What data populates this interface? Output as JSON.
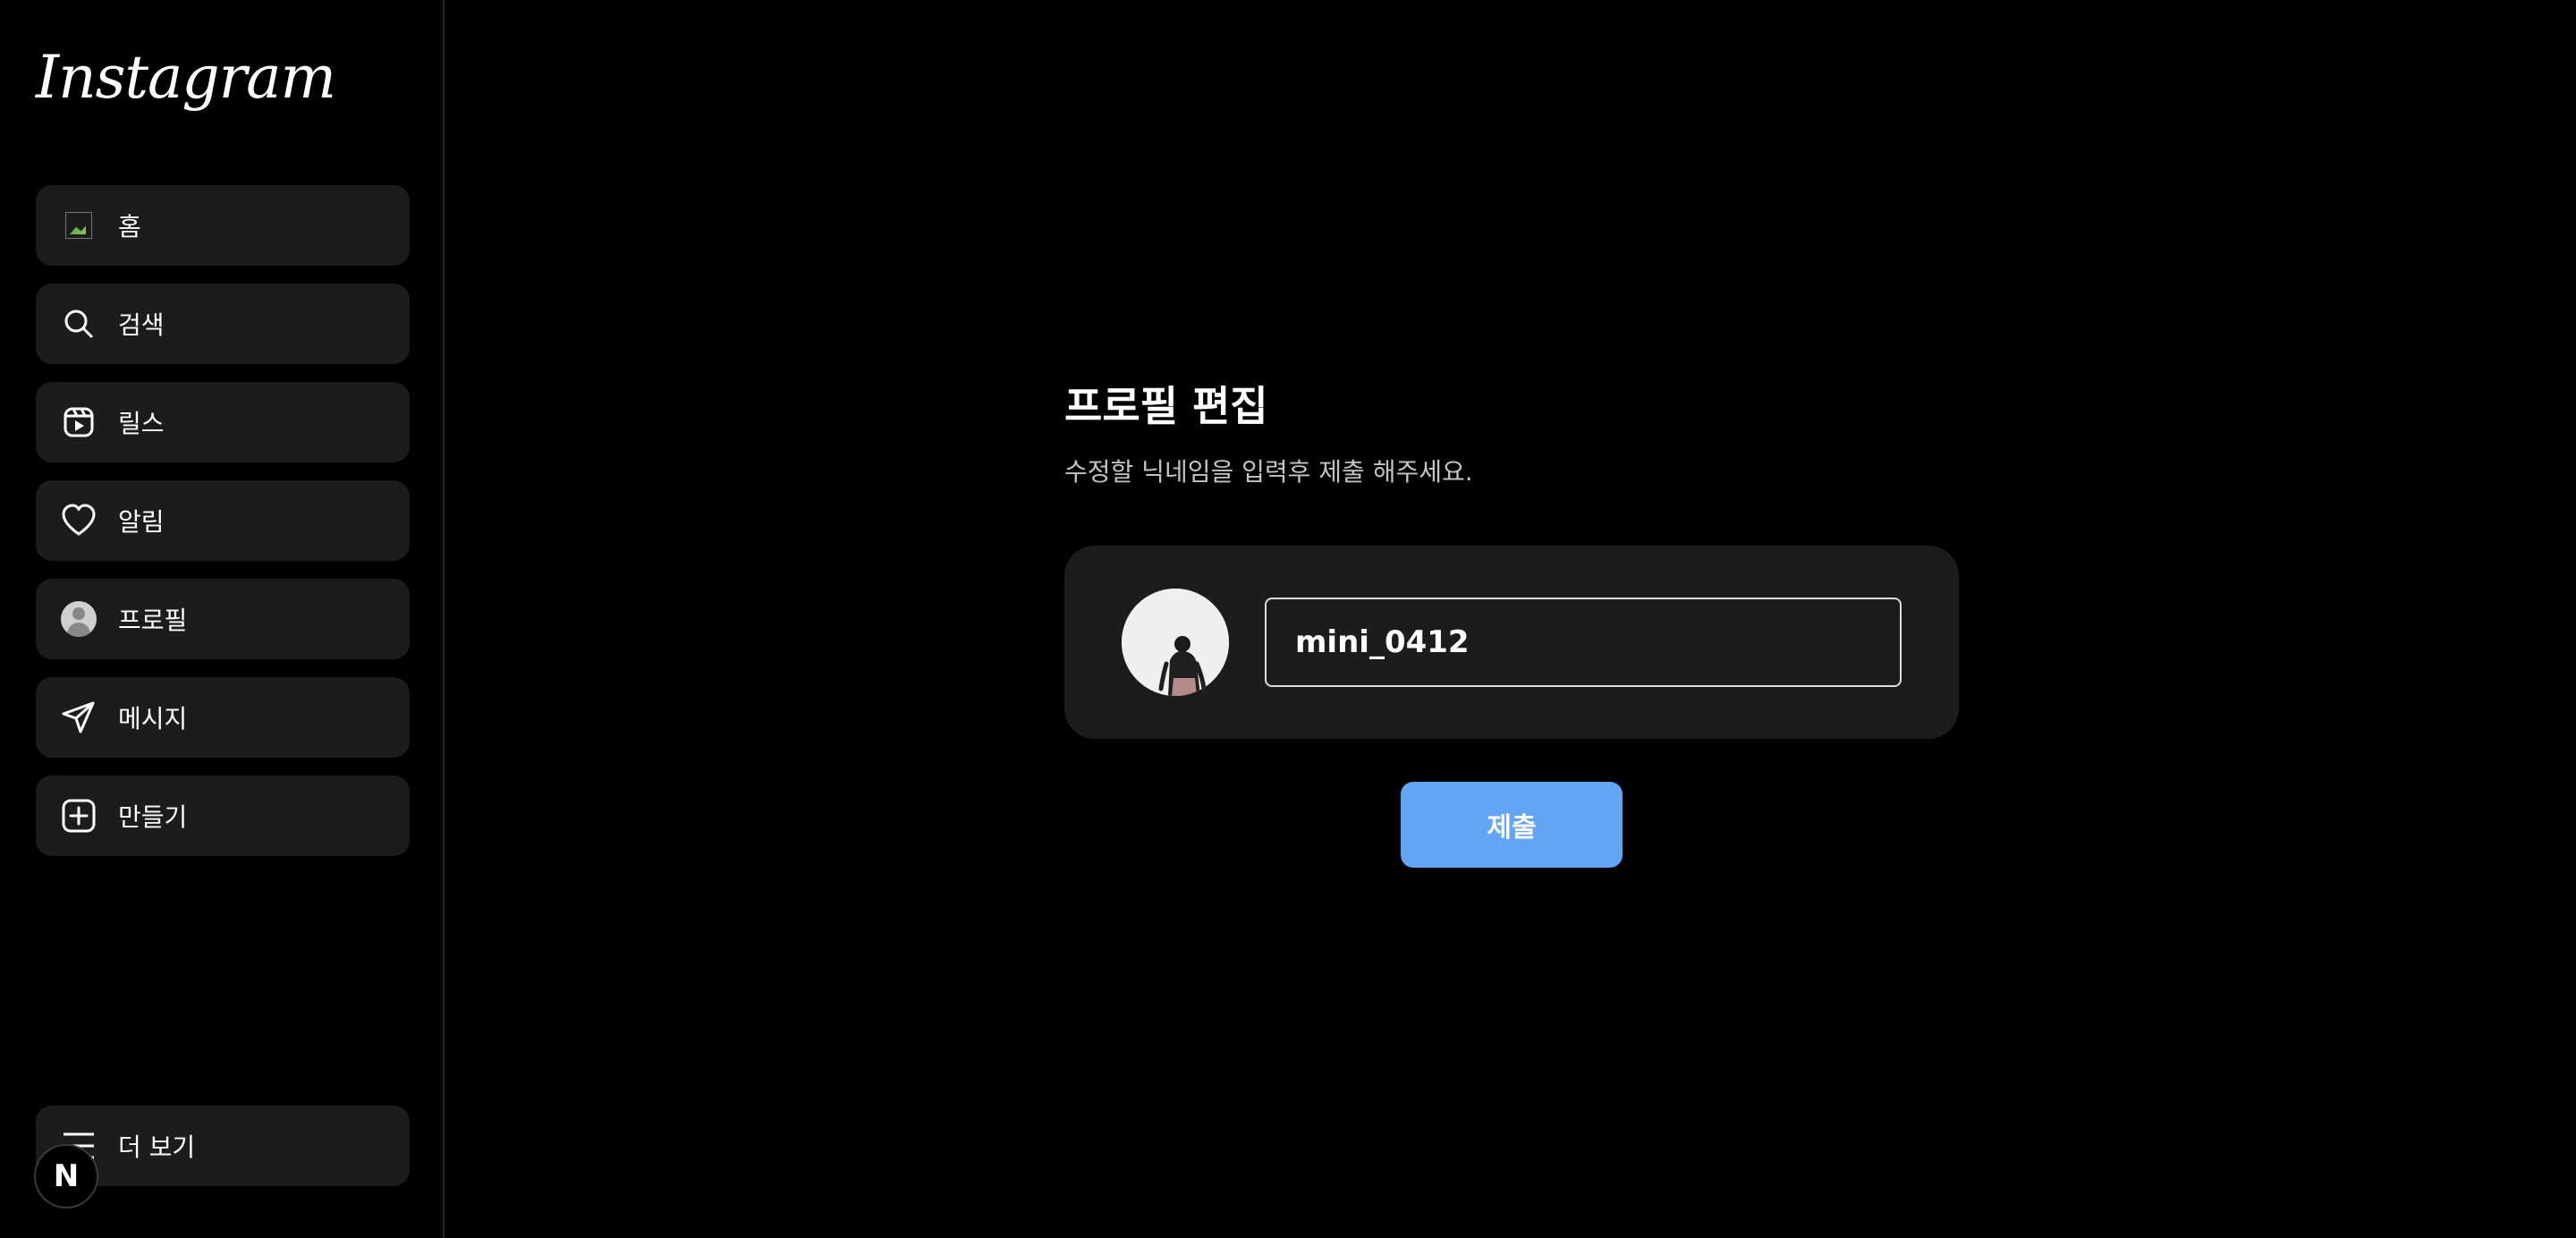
{
  "sidebar": {
    "logo": "Instagram",
    "items": [
      {
        "label": "홈",
        "icon": "home-image-icon"
      },
      {
        "label": "검색",
        "icon": "search-icon"
      },
      {
        "label": "릴스",
        "icon": "reels-icon"
      },
      {
        "label": "알림",
        "icon": "heart-icon"
      },
      {
        "label": "프로필",
        "icon": "profile-avatar-icon"
      },
      {
        "label": "메시지",
        "icon": "send-icon"
      },
      {
        "label": "만들기",
        "icon": "plus-square-icon"
      }
    ],
    "more": {
      "label": "더 보기",
      "icon": "menu-icon"
    }
  },
  "dev_badge": {
    "letter": "N"
  },
  "main": {
    "title": "프로필 편집",
    "subtitle": "수정할 닉네임을 입력후 제출 해주세요.",
    "nickname_value": "mini_0412",
    "submit_label": "제출"
  },
  "colors": {
    "background": "#000000",
    "card": "#1c1c1c",
    "accent": "#62a5f5"
  }
}
